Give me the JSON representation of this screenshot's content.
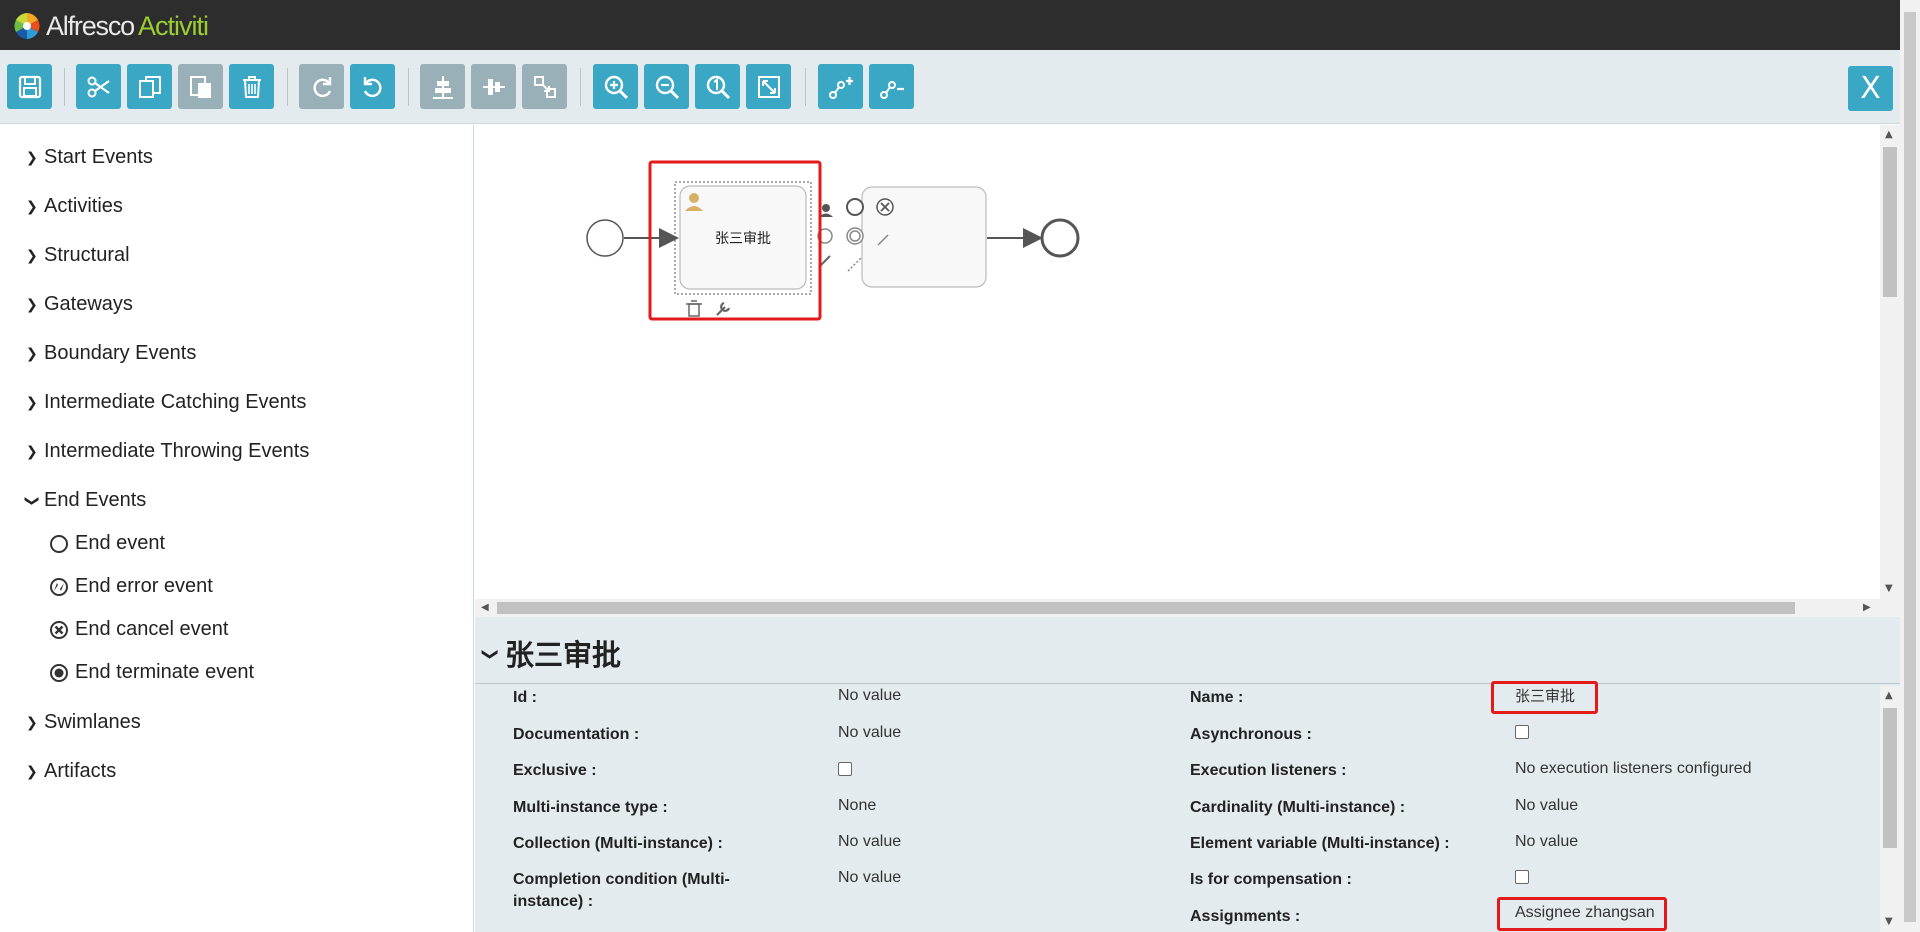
{
  "header": {
    "brand_part1": "Alfresco",
    "brand_part2": "Activiti",
    "colors": {
      "background": "#2d2d2d",
      "accent": "#9acd32"
    }
  },
  "toolbar": {
    "buttons": [
      {
        "name": "save",
        "icon": "save-icon",
        "enabled": true
      },
      {
        "name": "cut",
        "icon": "scissors-icon",
        "enabled": true
      },
      {
        "name": "copy",
        "icon": "copy-icon",
        "enabled": true
      },
      {
        "name": "paste",
        "icon": "paste-icon",
        "enabled": true
      },
      {
        "name": "delete",
        "icon": "trash-icon",
        "enabled": true
      },
      {
        "name": "redo",
        "icon": "redo-icon",
        "enabled": false
      },
      {
        "name": "undo",
        "icon": "undo-icon",
        "enabled": true
      },
      {
        "name": "align-horizontal",
        "icon": "align-horizontal-icon",
        "enabled": false
      },
      {
        "name": "align-vertical",
        "icon": "align-vertical-icon",
        "enabled": false
      },
      {
        "name": "same-size",
        "icon": "same-size-icon",
        "enabled": false
      },
      {
        "name": "zoom-in",
        "icon": "zoom-in-icon",
        "enabled": true
      },
      {
        "name": "zoom-out",
        "icon": "zoom-out-icon",
        "enabled": true
      },
      {
        "name": "zoom-actual",
        "icon": "zoom-actual-icon",
        "enabled": true
      },
      {
        "name": "zoom-fit",
        "icon": "zoom-fit-icon",
        "enabled": true
      },
      {
        "name": "add-bendpoint",
        "icon": "add-bendpoint-icon",
        "enabled": true
      },
      {
        "name": "remove-bendpoint",
        "icon": "remove-bendpoint-icon",
        "enabled": true
      }
    ],
    "close_label": "X",
    "colors": {
      "button": "#3aa7c4",
      "disabled": "#9ab0b8"
    }
  },
  "palette": {
    "groups": [
      {
        "label": "Start Events",
        "expanded": false
      },
      {
        "label": "Activities",
        "expanded": false
      },
      {
        "label": "Structural",
        "expanded": false
      },
      {
        "label": "Gateways",
        "expanded": false
      },
      {
        "label": "Boundary Events",
        "expanded": false
      },
      {
        "label": "Intermediate Catching Events",
        "expanded": false
      },
      {
        "label": "Intermediate Throwing Events",
        "expanded": false
      },
      {
        "label": "End Events",
        "expanded": true
      },
      {
        "label": "Swimlanes",
        "expanded": false
      },
      {
        "label": "Artifacts",
        "expanded": false
      }
    ],
    "end_event_items": [
      {
        "label": "End event",
        "icon": "end-event-icon"
      },
      {
        "label": "End error event",
        "icon": "end-error-event-icon"
      },
      {
        "label": "End cancel event",
        "icon": "end-cancel-event-icon"
      },
      {
        "label": "End terminate event",
        "icon": "end-terminate-event-icon"
      }
    ]
  },
  "canvas": {
    "task_label": "张三审批",
    "highlight_color": "#e21a1a"
  },
  "properties": {
    "title": "张三审批",
    "left_column": [
      {
        "label": "Id :",
        "value": "No value",
        "type": "text"
      },
      {
        "label": "Documentation :",
        "value": "No value",
        "type": "text"
      },
      {
        "label": "Exclusive :",
        "value": "",
        "type": "checkbox"
      },
      {
        "label": "Multi-instance type :",
        "value": "None",
        "type": "text"
      },
      {
        "label": "Collection (Multi-instance) :",
        "value": "No value",
        "type": "text"
      },
      {
        "label": "Completion condition (Multi-instance) :",
        "value": "No value",
        "type": "text"
      }
    ],
    "right_column": [
      {
        "label": "Name :",
        "value": "张三审批",
        "type": "text"
      },
      {
        "label": "Asynchronous :",
        "value": "",
        "type": "checkbox"
      },
      {
        "label": "Execution listeners :",
        "value": "No execution listeners configured",
        "type": "text"
      },
      {
        "label": "Cardinality (Multi-instance) :",
        "value": "No value",
        "type": "text"
      },
      {
        "label": "Element variable (Multi-instance) :",
        "value": "No value",
        "type": "text"
      },
      {
        "label": "Is for compensation :",
        "value": "",
        "type": "checkbox"
      },
      {
        "label": "Assignments :",
        "value": "Assignee zhangsan",
        "type": "text"
      }
    ]
  }
}
